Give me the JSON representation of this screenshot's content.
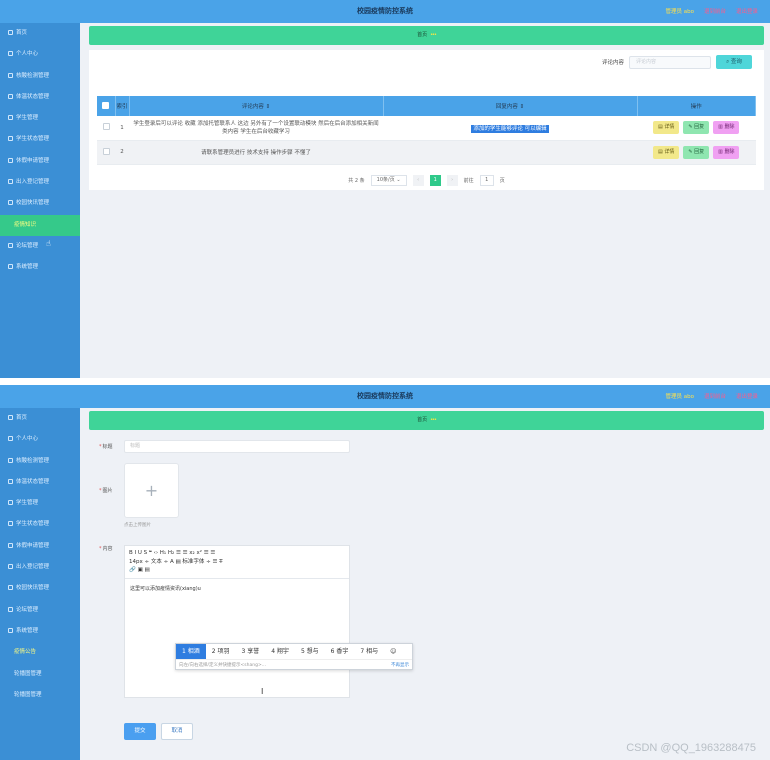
{
  "app": {
    "title": "校园疫情防控系统",
    "user": "管理员 abo",
    "link_home": "退到前台",
    "link_logout": "退出登录"
  },
  "menu1": [
    "首页",
    "个人中心",
    "核酸检测管理",
    "体温状态管理",
    "学生管理",
    "学生状态管理",
    "休假申请管理",
    "出入登记管理",
    "校园快讯管理",
    "疫情知识",
    "论坛管理",
    "系统管理"
  ],
  "menu2": [
    "首页",
    "个人中心",
    "核酸检测管理",
    "体温状态管理",
    "学生管理",
    "学生状态管理",
    "休假申请管理",
    "出入登记管理",
    "校园快讯管理",
    "论坛管理",
    "系统管理",
    "疫情公告",
    "轮播图管理",
    "轮播图管理"
  ],
  "breadcrumb": {
    "home": "首页",
    "current": "•••"
  },
  "search": {
    "label": "评论内容",
    "placeholder": "评论内容",
    "button": "查询"
  },
  "table": {
    "headers": [
      "索引",
      "评论内容",
      "回复内容",
      "操作"
    ],
    "rows": [
      {
        "index": "1",
        "comment": "学生登录后可以评论 收藏 添加托管联系人 这边 另外有了一个设置联动模块 然后在后台添加相关新闻类内容 学生在后台收藏学习",
        "reply": "添加的学生能够评论 可以编辑"
      },
      {
        "index": "2",
        "comment": "请联系管理员进行 技术支持 操作步骤 不懂了",
        "reply": ""
      }
    ],
    "ops": {
      "detail": "详情",
      "edit": "回复",
      "delete": "删除"
    }
  },
  "pager": {
    "total": "共 2 条",
    "size": "10条/页",
    "page": "1",
    "goto": "前往",
    "goto_page": "1",
    "unit": "页"
  },
  "form": {
    "title_label": "标题",
    "title_placeholder": "标题",
    "image_label": "图片",
    "upload_tip": "点击上传图片",
    "content_label": "内容",
    "toolbar_row1": "B  I  U  S    ❝  ‹›    H₁  H₂    ☰  ☰    x₂  x²    ☰  ☰",
    "toolbar_row2": "14px  ÷  文本  ÷  A  ▤  标准字体  ÷  ☰  T̶",
    "toolbar_row3": "🔗  ▣  ▤",
    "editor_text": "这里可以添加疫情资讯(xiang)u",
    "ime_candidates": [
      "1 相酒",
      "2 项羽",
      "3 享誉",
      "4 翔宇",
      "5 想与",
      "6 香宇",
      "7 相与"
    ],
    "ime_hint": "向左/向右选择/定义并快捷提示<shang>...",
    "ime_more": "不再显示",
    "submit": "提交",
    "cancel": "取消"
  },
  "watermark": "CSDN @QQ_1963288475"
}
